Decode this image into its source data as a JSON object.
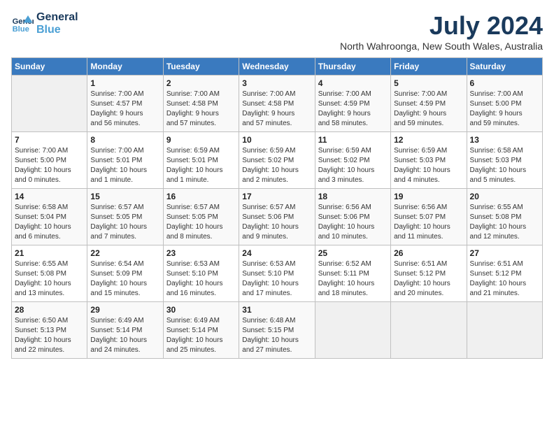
{
  "header": {
    "logo_line1": "General",
    "logo_line2": "Blue",
    "month_year": "July 2024",
    "location": "North Wahroonga, New South Wales, Australia"
  },
  "days_of_week": [
    "Sunday",
    "Monday",
    "Tuesday",
    "Wednesday",
    "Thursday",
    "Friday",
    "Saturday"
  ],
  "weeks": [
    [
      {
        "day": "",
        "info": ""
      },
      {
        "day": "1",
        "info": "Sunrise: 7:00 AM\nSunset: 4:57 PM\nDaylight: 9 hours\nand 56 minutes."
      },
      {
        "day": "2",
        "info": "Sunrise: 7:00 AM\nSunset: 4:58 PM\nDaylight: 9 hours\nand 57 minutes."
      },
      {
        "day": "3",
        "info": "Sunrise: 7:00 AM\nSunset: 4:58 PM\nDaylight: 9 hours\nand 57 minutes."
      },
      {
        "day": "4",
        "info": "Sunrise: 7:00 AM\nSunset: 4:59 PM\nDaylight: 9 hours\nand 58 minutes."
      },
      {
        "day": "5",
        "info": "Sunrise: 7:00 AM\nSunset: 4:59 PM\nDaylight: 9 hours\nand 59 minutes."
      },
      {
        "day": "6",
        "info": "Sunrise: 7:00 AM\nSunset: 5:00 PM\nDaylight: 9 hours\nand 59 minutes."
      }
    ],
    [
      {
        "day": "7",
        "info": "Sunrise: 7:00 AM\nSunset: 5:00 PM\nDaylight: 10 hours\nand 0 minutes."
      },
      {
        "day": "8",
        "info": "Sunrise: 7:00 AM\nSunset: 5:01 PM\nDaylight: 10 hours\nand 1 minute."
      },
      {
        "day": "9",
        "info": "Sunrise: 6:59 AM\nSunset: 5:01 PM\nDaylight: 10 hours\nand 1 minute."
      },
      {
        "day": "10",
        "info": "Sunrise: 6:59 AM\nSunset: 5:02 PM\nDaylight: 10 hours\nand 2 minutes."
      },
      {
        "day": "11",
        "info": "Sunrise: 6:59 AM\nSunset: 5:02 PM\nDaylight: 10 hours\nand 3 minutes."
      },
      {
        "day": "12",
        "info": "Sunrise: 6:59 AM\nSunset: 5:03 PM\nDaylight: 10 hours\nand 4 minutes."
      },
      {
        "day": "13",
        "info": "Sunrise: 6:58 AM\nSunset: 5:03 PM\nDaylight: 10 hours\nand 5 minutes."
      }
    ],
    [
      {
        "day": "14",
        "info": "Sunrise: 6:58 AM\nSunset: 5:04 PM\nDaylight: 10 hours\nand 6 minutes."
      },
      {
        "day": "15",
        "info": "Sunrise: 6:57 AM\nSunset: 5:05 PM\nDaylight: 10 hours\nand 7 minutes."
      },
      {
        "day": "16",
        "info": "Sunrise: 6:57 AM\nSunset: 5:05 PM\nDaylight: 10 hours\nand 8 minutes."
      },
      {
        "day": "17",
        "info": "Sunrise: 6:57 AM\nSunset: 5:06 PM\nDaylight: 10 hours\nand 9 minutes."
      },
      {
        "day": "18",
        "info": "Sunrise: 6:56 AM\nSunset: 5:06 PM\nDaylight: 10 hours\nand 10 minutes."
      },
      {
        "day": "19",
        "info": "Sunrise: 6:56 AM\nSunset: 5:07 PM\nDaylight: 10 hours\nand 11 minutes."
      },
      {
        "day": "20",
        "info": "Sunrise: 6:55 AM\nSunset: 5:08 PM\nDaylight: 10 hours\nand 12 minutes."
      }
    ],
    [
      {
        "day": "21",
        "info": "Sunrise: 6:55 AM\nSunset: 5:08 PM\nDaylight: 10 hours\nand 13 minutes."
      },
      {
        "day": "22",
        "info": "Sunrise: 6:54 AM\nSunset: 5:09 PM\nDaylight: 10 hours\nand 15 minutes."
      },
      {
        "day": "23",
        "info": "Sunrise: 6:53 AM\nSunset: 5:10 PM\nDaylight: 10 hours\nand 16 minutes."
      },
      {
        "day": "24",
        "info": "Sunrise: 6:53 AM\nSunset: 5:10 PM\nDaylight: 10 hours\nand 17 minutes."
      },
      {
        "day": "25",
        "info": "Sunrise: 6:52 AM\nSunset: 5:11 PM\nDaylight: 10 hours\nand 18 minutes."
      },
      {
        "day": "26",
        "info": "Sunrise: 6:51 AM\nSunset: 5:12 PM\nDaylight: 10 hours\nand 20 minutes."
      },
      {
        "day": "27",
        "info": "Sunrise: 6:51 AM\nSunset: 5:12 PM\nDaylight: 10 hours\nand 21 minutes."
      }
    ],
    [
      {
        "day": "28",
        "info": "Sunrise: 6:50 AM\nSunset: 5:13 PM\nDaylight: 10 hours\nand 22 minutes."
      },
      {
        "day": "29",
        "info": "Sunrise: 6:49 AM\nSunset: 5:14 PM\nDaylight: 10 hours\nand 24 minutes."
      },
      {
        "day": "30",
        "info": "Sunrise: 6:49 AM\nSunset: 5:14 PM\nDaylight: 10 hours\nand 25 minutes."
      },
      {
        "day": "31",
        "info": "Sunrise: 6:48 AM\nSunset: 5:15 PM\nDaylight: 10 hours\nand 27 minutes."
      },
      {
        "day": "",
        "info": ""
      },
      {
        "day": "",
        "info": ""
      },
      {
        "day": "",
        "info": ""
      }
    ]
  ]
}
